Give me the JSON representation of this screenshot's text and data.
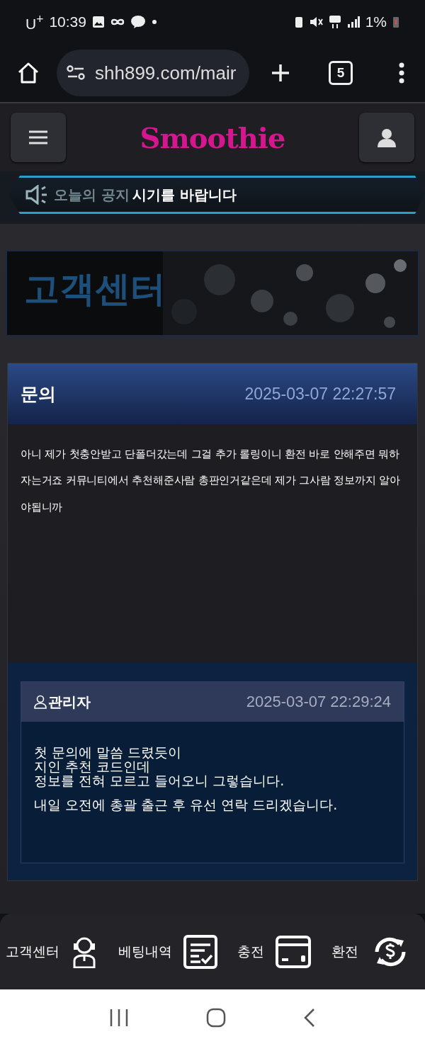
{
  "status_bar": {
    "carrier": "U$^{+}$",
    "time": "10:39",
    "battery": "1%"
  },
  "browser": {
    "url": "shh899.com/mair",
    "tab_count": "5"
  },
  "header": {
    "logo": "Smoothie"
  },
  "notice": {
    "label": "오늘의 공지",
    "message": "시기를 바랍니다"
  },
  "banner": {
    "title": "고객센터",
    "kind": "picture"
  },
  "inquiry": {
    "title": "문의",
    "date": "2025-03-07 22:27:57",
    "body": "아니 제가 첫충안받고 단폴더갔는데 그걸 추가 롤링이니 환전 바로 안해주면 뭐하자는거죠 커뮤니티에서 추천해준사람 총판인거같은데 제가 그사람 정보까지 알아야됩니까"
  },
  "reply": {
    "author": "관리자",
    "date": "2025-03-07 22:29:24",
    "paragraphs": [
      "첫 문의에 말씀 드렸듯이\n지인 추천 코드인데\n정보를 전혀 모르고 들어오니 그렇습니다.",
      "내일 오전에 총괄 출근 후 유선 연락 드리겠습니다."
    ]
  },
  "bottom_nav": [
    {
      "label": "고객센터",
      "kind": "headset"
    },
    {
      "label": "베팅내역",
      "kind": "list"
    },
    {
      "label": "충전",
      "kind": "card"
    },
    {
      "label": "환전",
      "kind": "exchange"
    }
  ]
}
